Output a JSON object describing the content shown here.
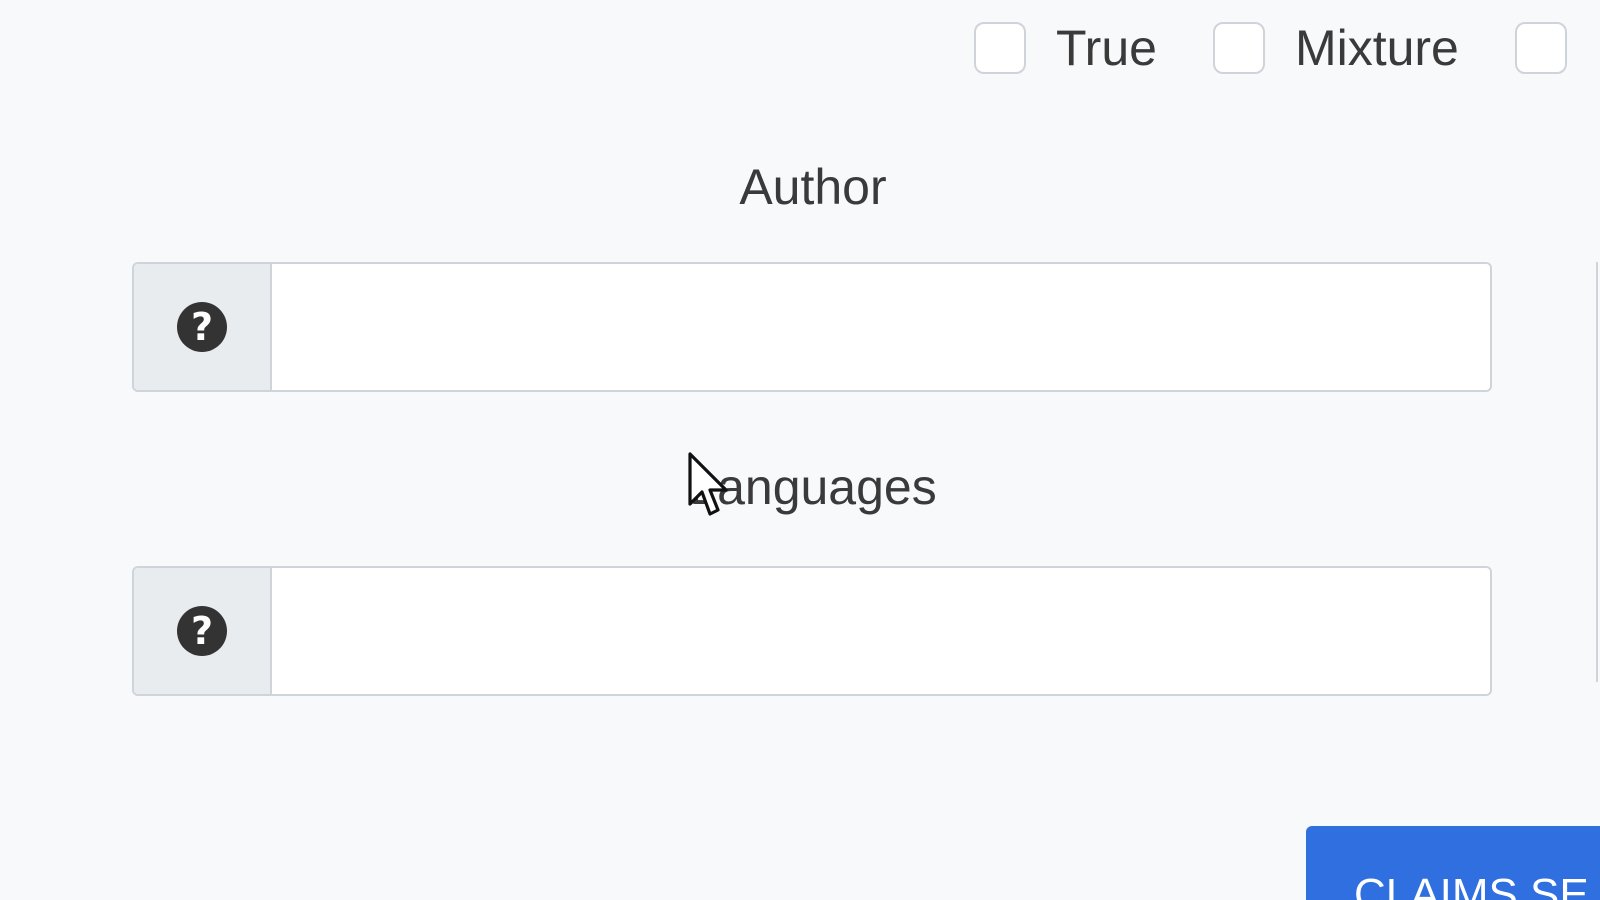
{
  "ratings": {
    "options": [
      {
        "label": "True",
        "checked": false
      },
      {
        "label": "Mixture",
        "checked": false
      },
      {
        "label": "",
        "checked": false
      }
    ]
  },
  "fields": {
    "author": {
      "label": "Author",
      "value": "",
      "placeholder": "",
      "help_icon": "question-circle-icon"
    },
    "languages": {
      "label": "Languages",
      "value": "",
      "placeholder": "",
      "help_icon": "question-circle-icon"
    }
  },
  "actions": {
    "claims_search_label": "CLAIMS SE"
  },
  "colors": {
    "primary": "#2f6fe0",
    "background": "#f8f9fa",
    "addon_bg": "#e9ecef",
    "border": "#ced4da"
  }
}
